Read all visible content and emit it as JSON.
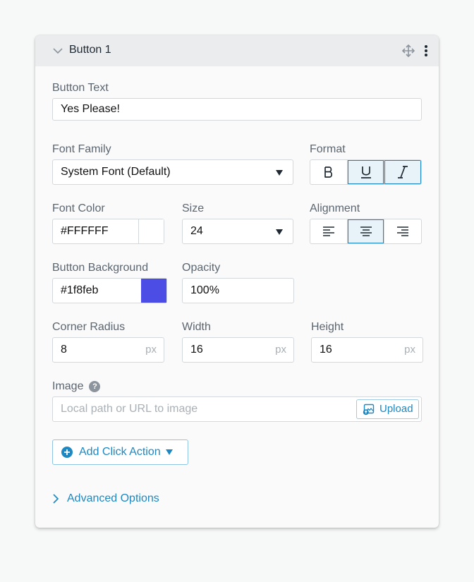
{
  "header": {
    "title": "Button 1",
    "collapse_icon": "chevron-down-icon",
    "move_icon": "move-icon",
    "more_icon": "more-vertical-icon"
  },
  "button_text": {
    "label": "Button Text",
    "value": "Yes Please!"
  },
  "font_family": {
    "label": "Font Family",
    "value": "System Font (Default)"
  },
  "format": {
    "label": "Format",
    "options": [
      "bold",
      "underline",
      "italic"
    ],
    "active": [
      "underline",
      "italic"
    ]
  },
  "font_color": {
    "label": "Font Color",
    "value": "#FFFFFF",
    "swatch": "#ffffff"
  },
  "size": {
    "label": "Size",
    "value": "24"
  },
  "alignment": {
    "label": "Alignment",
    "options": [
      "left",
      "center",
      "right"
    ],
    "active": "center"
  },
  "button_background": {
    "label": "Button Background",
    "value": "#1f8feb",
    "swatch": "#4b4de4"
  },
  "opacity": {
    "label": "Opacity",
    "value": "100%"
  },
  "corner_radius": {
    "label": "Corner Radius",
    "value": "8",
    "unit": "px"
  },
  "width": {
    "label": "Width",
    "value": "16",
    "unit": "px"
  },
  "height": {
    "label": "Height",
    "value": "16",
    "unit": "px"
  },
  "image": {
    "label": "Image",
    "placeholder": "Local path or URL to image",
    "upload_label": "Upload"
  },
  "click_action": {
    "label": "Add Click Action"
  },
  "advanced": {
    "label": "Advanced Options"
  },
  "colors": {
    "accent": "#1d88c2",
    "active_bg": "#e8f3f9",
    "border": "#d3d8dc"
  }
}
